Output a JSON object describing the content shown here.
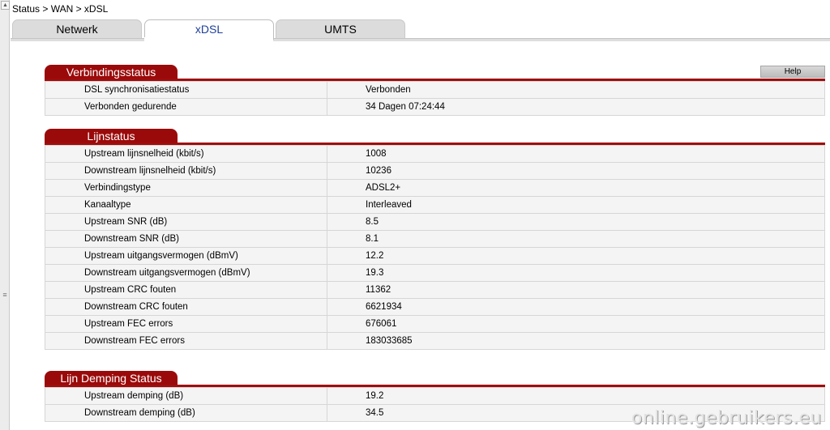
{
  "breadcrumb": "Status > WAN > xDSL",
  "tabs": [
    {
      "label": "Netwerk",
      "active": false
    },
    {
      "label": "xDSL",
      "active": true
    },
    {
      "label": "UMTS",
      "active": false
    }
  ],
  "colors": {
    "accent": "#9b0a0a",
    "active_tab_text": "#1f3f9a"
  },
  "help_label": "Help",
  "sections": [
    {
      "title": "Verbindingsstatus",
      "rows": [
        {
          "label": "DSL synchronisatiestatus",
          "value": "Verbonden"
        },
        {
          "label": "Verbonden gedurende",
          "value": "34 Dagen 07:24:44"
        }
      ]
    },
    {
      "title": "Lijnstatus",
      "rows": [
        {
          "label": "Upstream lijnsnelheid (kbit/s)",
          "value": "1008"
        },
        {
          "label": "Downstream lijnsnelheid (kbit/s)",
          "value": "10236"
        },
        {
          "label": "Verbindingstype",
          "value": "ADSL2+"
        },
        {
          "label": "Kanaaltype",
          "value": "Interleaved"
        },
        {
          "label": "Upstream SNR (dB)",
          "value": "8.5"
        },
        {
          "label": "Downstream SNR (dB)",
          "value": "8.1"
        },
        {
          "label": "Upstream uitgangsvermogen (dBmV)",
          "value": "12.2"
        },
        {
          "label": "Downstream uitgangsvermogen (dBmV)",
          "value": "19.3"
        },
        {
          "label": "Upstream CRC fouten",
          "value": "11362"
        },
        {
          "label": "Downstream CRC fouten",
          "value": "6621934"
        },
        {
          "label": "Upstream FEC errors",
          "value": "676061"
        },
        {
          "label": "Downstream FEC errors",
          "value": "183033685"
        }
      ]
    },
    {
      "title": "Lijn Demping Status",
      "rows": [
        {
          "label": "Upstream demping (dB)",
          "value": "19.2"
        },
        {
          "label": "Downstream demping (dB)",
          "value": "34.5"
        }
      ]
    }
  ],
  "watermark": "online.gebruikers.eu"
}
